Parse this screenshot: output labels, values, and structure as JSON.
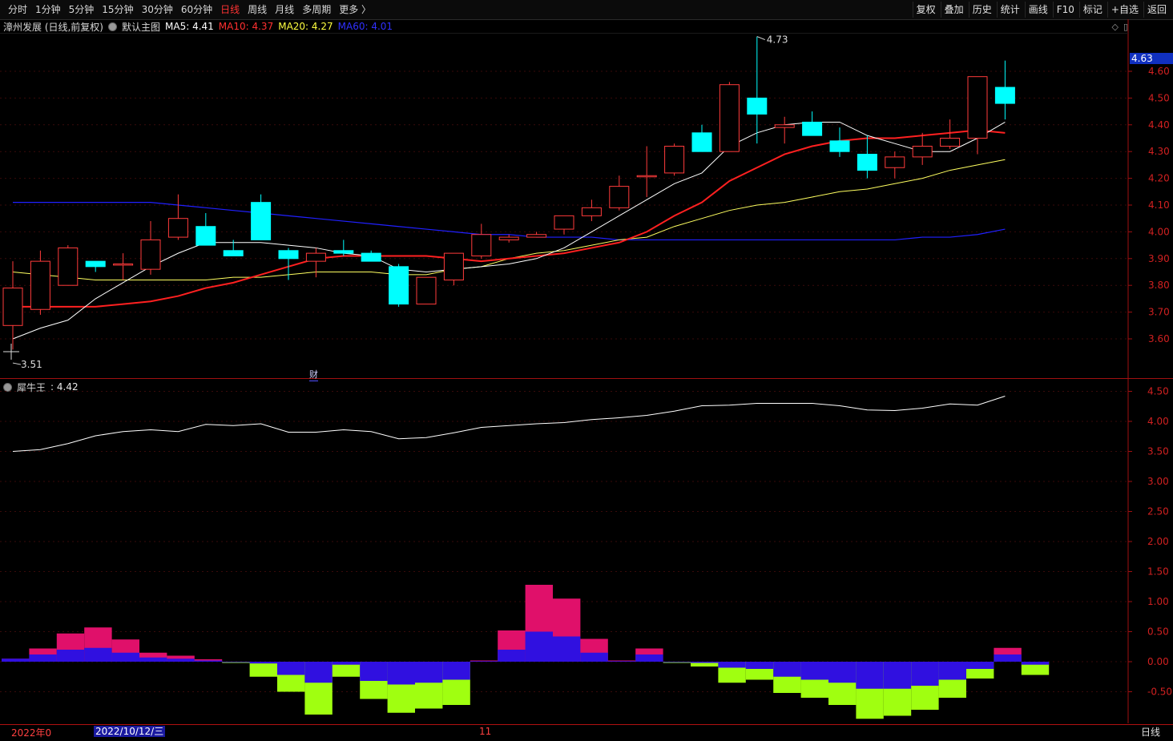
{
  "toolbar": {
    "periods": [
      "分时",
      "1分钟",
      "5分钟",
      "15分钟",
      "30分钟",
      "60分钟",
      "日线",
      "周线",
      "月线",
      "多周期",
      "更多 〉"
    ],
    "active": "日线",
    "actions": [
      "复权",
      "叠加",
      "历史",
      "统计",
      "画线",
      "F10",
      "标记",
      "+自选",
      "返回"
    ]
  },
  "main_legend": {
    "stock": "漳州发展 (日线,前复权)",
    "template": "默认主图",
    "ma5": "MA5: 4.41",
    "ma10": "MA10: 4.37",
    "ma20": "MA20: 4.27",
    "ma60": "MA60: 4.01"
  },
  "indicator_legend": {
    "name": "犀牛王",
    "value": ": 4.42"
  },
  "colors": {
    "up": "#ff3b3b",
    "down": "#00ffff",
    "ma5": "#ffffff",
    "ma10": "#ff2020",
    "ma20": "#ffff60",
    "ma60": "#2020ff",
    "hist_pos": "#e0106a",
    "hist_pos_inner": "#3010e0",
    "hist_neg": "#a0ff10",
    "hist_neg_inner": "#3010e0"
  },
  "price_axis": [
    "4.60",
    "4.50",
    "4.40",
    "4.30",
    "4.20",
    "4.10",
    "4.00",
    "3.90",
    "3.80",
    "3.70",
    "3.60"
  ],
  "current_price": "4.63",
  "high_label": "4.73",
  "low_label": "3.51",
  "ind_axis": [
    "4.50",
    "4.00",
    "3.50",
    "3.00",
    "2.50",
    "2.00",
    "1.50",
    "1.00",
    "0.50",
    "0.00",
    "-0.50"
  ],
  "fin_mark": "财",
  "bottom": {
    "start": "2022年0",
    "cursor": "2022/10/12/三",
    "mid": "11",
    "period": "日线"
  },
  "chart_data": {
    "type": "candlestick",
    "ohlc": [
      [
        3.65,
        3.89,
        3.56,
        3.79
      ],
      [
        3.71,
        3.93,
        3.69,
        3.89
      ],
      [
        3.8,
        3.95,
        3.8,
        3.94
      ],
      [
        3.89,
        3.89,
        3.85,
        3.87
      ],
      [
        3.88,
        3.92,
        3.82,
        3.88
      ],
      [
        3.86,
        4.04,
        3.84,
        3.97
      ],
      [
        3.98,
        4.14,
        3.97,
        4.05
      ],
      [
        4.02,
        4.07,
        3.95,
        3.95
      ],
      [
        3.93,
        3.97,
        3.91,
        3.91
      ],
      [
        4.11,
        4.14,
        3.97,
        3.97
      ],
      [
        3.93,
        3.94,
        3.82,
        3.9
      ],
      [
        3.89,
        3.94,
        3.83,
        3.92
      ],
      [
        3.93,
        3.97,
        3.91,
        3.92
      ],
      [
        3.92,
        3.93,
        3.89,
        3.89
      ],
      [
        3.87,
        3.88,
        3.72,
        3.73
      ],
      [
        3.73,
        3.83,
        3.73,
        3.83
      ],
      [
        3.82,
        3.92,
        3.8,
        3.92
      ],
      [
        3.91,
        4.03,
        3.9,
        3.99
      ],
      [
        3.97,
        3.99,
        3.96,
        3.98
      ],
      [
        3.98,
        4.0,
        3.98,
        3.99
      ],
      [
        4.01,
        4.06,
        3.99,
        4.06
      ],
      [
        4.06,
        4.12,
        4.04,
        4.09
      ],
      [
        4.09,
        4.21,
        4.08,
        4.17
      ],
      [
        4.21,
        4.32,
        4.13,
        4.21
      ],
      [
        4.22,
        4.33,
        4.21,
        4.32
      ],
      [
        4.37,
        4.4,
        4.3,
        4.3
      ],
      [
        4.3,
        4.56,
        4.3,
        4.55
      ],
      [
        4.5,
        4.73,
        4.33,
        4.44
      ],
      [
        4.39,
        4.43,
        4.33,
        4.4
      ],
      [
        4.41,
        4.45,
        4.36,
        4.36
      ],
      [
        4.34,
        4.39,
        4.28,
        4.3
      ],
      [
        4.29,
        4.36,
        4.2,
        4.23
      ],
      [
        4.24,
        4.3,
        4.2,
        4.28
      ],
      [
        4.28,
        4.37,
        4.25,
        4.32
      ],
      [
        4.32,
        4.42,
        4.31,
        4.35
      ],
      [
        4.35,
        4.58,
        4.29,
        4.58
      ],
      [
        4.54,
        4.64,
        4.42,
        4.48
      ]
    ],
    "ma5": [
      3.6,
      3.64,
      3.67,
      3.75,
      3.81,
      3.87,
      3.92,
      3.96,
      3.96,
      3.96,
      3.95,
      3.94,
      3.92,
      3.91,
      3.86,
      3.85,
      3.86,
      3.87,
      3.88,
      3.9,
      3.94,
      4.0,
      4.06,
      4.12,
      4.18,
      4.22,
      4.32,
      4.37,
      4.4,
      4.41,
      4.41,
      4.36,
      4.33,
      4.3,
      4.3,
      4.35,
      4.41
    ],
    "ma10": [
      3.72,
      3.72,
      3.72,
      3.72,
      3.73,
      3.74,
      3.76,
      3.79,
      3.81,
      3.84,
      3.87,
      3.9,
      3.91,
      3.91,
      3.91,
      3.91,
      3.9,
      3.89,
      3.9,
      3.91,
      3.92,
      3.94,
      3.96,
      4.0,
      4.06,
      4.11,
      4.19,
      4.24,
      4.29,
      4.32,
      4.34,
      4.35,
      4.35,
      4.36,
      4.37,
      4.38,
      4.37
    ],
    "ma20": [
      3.85,
      3.84,
      3.83,
      3.82,
      3.82,
      3.82,
      3.82,
      3.82,
      3.83,
      3.83,
      3.84,
      3.85,
      3.85,
      3.85,
      3.84,
      3.84,
      3.86,
      3.87,
      3.9,
      3.92,
      3.93,
      3.95,
      3.97,
      3.98,
      4.02,
      4.05,
      4.08,
      4.1,
      4.11,
      4.13,
      4.15,
      4.16,
      4.18,
      4.2,
      4.23,
      4.25,
      4.27
    ],
    "ma60": [
      4.11,
      4.11,
      4.11,
      4.11,
      4.11,
      4.11,
      4.1,
      4.09,
      4.08,
      4.07,
      4.06,
      4.05,
      4.04,
      4.03,
      4.02,
      4.01,
      4.0,
      3.99,
      3.99,
      3.98,
      3.98,
      3.98,
      3.97,
      3.97,
      3.97,
      3.97,
      3.97,
      3.97,
      3.97,
      3.97,
      3.97,
      3.97,
      3.97,
      3.98,
      3.98,
      3.99,
      4.01
    ],
    "indicator_line": [
      3.5,
      3.53,
      3.63,
      3.76,
      3.83,
      3.86,
      3.83,
      3.95,
      3.93,
      3.96,
      3.82,
      3.82,
      3.86,
      3.83,
      3.71,
      3.73,
      3.81,
      3.9,
      3.93,
      3.96,
      3.98,
      4.03,
      4.06,
      4.1,
      4.17,
      4.26,
      4.27,
      4.3,
      4.3,
      4.3,
      4.26,
      4.19,
      4.18,
      4.22,
      4.29,
      4.27,
      4.42
    ],
    "histogram": [
      [
        0.05,
        0.05
      ],
      [
        0.22,
        0.12
      ],
      [
        0.47,
        0.2
      ],
      [
        0.57,
        0.23
      ],
      [
        0.37,
        0.15
      ],
      [
        0.15,
        0.07
      ],
      [
        0.1,
        0.05
      ],
      [
        0.04,
        0.02
      ],
      [
        -0.02,
        -0.01
      ],
      [
        -0.25,
        -0.03
      ],
      [
        -0.5,
        -0.22
      ],
      [
        -0.88,
        -0.35
      ],
      [
        -0.25,
        -0.05
      ],
      [
        -0.62,
        -0.32
      ],
      [
        -0.85,
        -0.38
      ],
      [
        -0.78,
        -0.35
      ],
      [
        -0.72,
        -0.3
      ],
      [
        0.02,
        0.01
      ],
      [
        0.52,
        0.2
      ],
      [
        1.28,
        0.5
      ],
      [
        1.05,
        0.42
      ],
      [
        0.38,
        0.15
      ],
      [
        0.02,
        0.01
      ],
      [
        0.22,
        0.12
      ],
      [
        -0.02,
        -0.01
      ],
      [
        -0.08,
        -0.02
      ],
      [
        -0.35,
        -0.1
      ],
      [
        -0.3,
        -0.12
      ],
      [
        -0.52,
        -0.25
      ],
      [
        -0.6,
        -0.3
      ],
      [
        -0.72,
        -0.35
      ],
      [
        -0.95,
        -0.45
      ],
      [
        -0.9,
        -0.45
      ],
      [
        -0.8,
        -0.4
      ],
      [
        -0.6,
        -0.3
      ],
      [
        -0.28,
        -0.12
      ],
      [
        0.23,
        0.12
      ],
      [
        -0.22,
        -0.05
      ]
    ]
  }
}
